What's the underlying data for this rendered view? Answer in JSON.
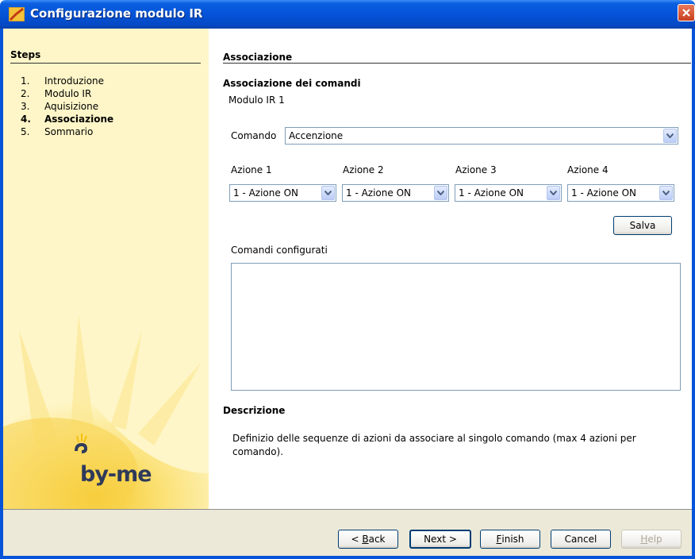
{
  "window": {
    "title": "Configurazione modulo IR",
    "app_icon": "application-icon",
    "close_icon": "close-icon",
    "title_color": "#0553d8"
  },
  "steps": {
    "header": "Steps",
    "items": [
      {
        "num": "1.",
        "label": "Introduzione"
      },
      {
        "num": "2.",
        "label": "Modulo IR"
      },
      {
        "num": "3.",
        "label": "Aquisizione"
      },
      {
        "num": "4.",
        "label": "Associazione"
      },
      {
        "num": "5.",
        "label": "Sommario"
      }
    ],
    "current_index": 3,
    "logo": "by-me"
  },
  "main": {
    "section_title": "Associazione",
    "assoc_title": "Associazione dei comandi",
    "module": "Modulo IR 1",
    "comando_label": "Comando",
    "comando_value": "Accenzione",
    "azioni": [
      {
        "label": "Azione 1",
        "value": "1 - Azione ON"
      },
      {
        "label": "Azione 2",
        "value": "1 - Azione ON"
      },
      {
        "label": "Azione 3",
        "value": "1 - Azione ON"
      },
      {
        "label": "Azione 4",
        "value": "1 - Azione ON"
      }
    ],
    "salva_label": "Salva",
    "configured_label": "Comandi configurati",
    "description_title": "Descrizione",
    "description_text": "Definizio delle sequenze di azioni da associare al singolo comando (max 4 azioni per comando)."
  },
  "buttons": {
    "back": {
      "prefix": "< ",
      "mnemonic": "B",
      "rest": "ack"
    },
    "next": "Next >",
    "finish": {
      "mnemonic": "F",
      "rest": "inish"
    },
    "cancel": "Cancel",
    "help": {
      "mnemonic": "H",
      "rest": "elp"
    }
  }
}
